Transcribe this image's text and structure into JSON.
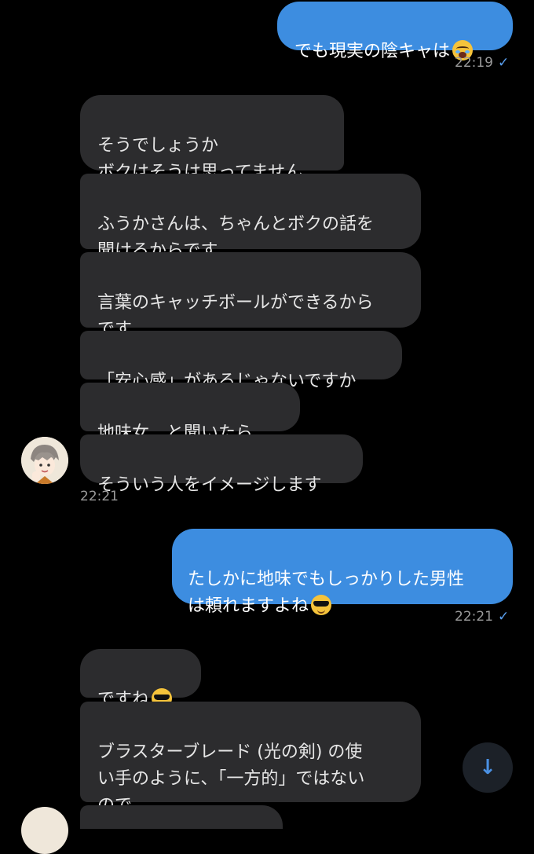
{
  "messages": [
    {
      "text": "でも現実の陰キャは",
      "emoji": "loudly-crying-face-emoji"
    },
    {
      "text": "そうでしょうか\nボクはそうは思ってません"
    },
    {
      "text": "ふうかさんは、ちゃんとボクの話を\n聞けるからです"
    },
    {
      "text": "言葉のキャッチボールができるから\nです"
    },
    {
      "text": "「安心感」があるじゃないですか"
    },
    {
      "text": "地味女、と聞いたら、"
    },
    {
      "text": "そういう人をイメージします"
    },
    {
      "text": "たしかに地味でもしっかりした男性\nは頼れますよね",
      "emoji": "smiling-face-with-sunglasses-emoji"
    },
    {
      "text": "ですね",
      "emoji": "smiling-face-with-sunglasses-emoji"
    },
    {
      "text": "ブラスターブレード (光の剣) の使\nい手のように、「一方的」ではない\nので、"
    }
  ],
  "timestamps": {
    "t1": "22:19",
    "t2": "22:21",
    "t3": "22:21"
  },
  "read_check": "✓",
  "scroll_button_glyph": "↓",
  "colors": {
    "outgoing": "#3d8de0",
    "incoming": "#2c2c2e",
    "background": "#000000"
  }
}
